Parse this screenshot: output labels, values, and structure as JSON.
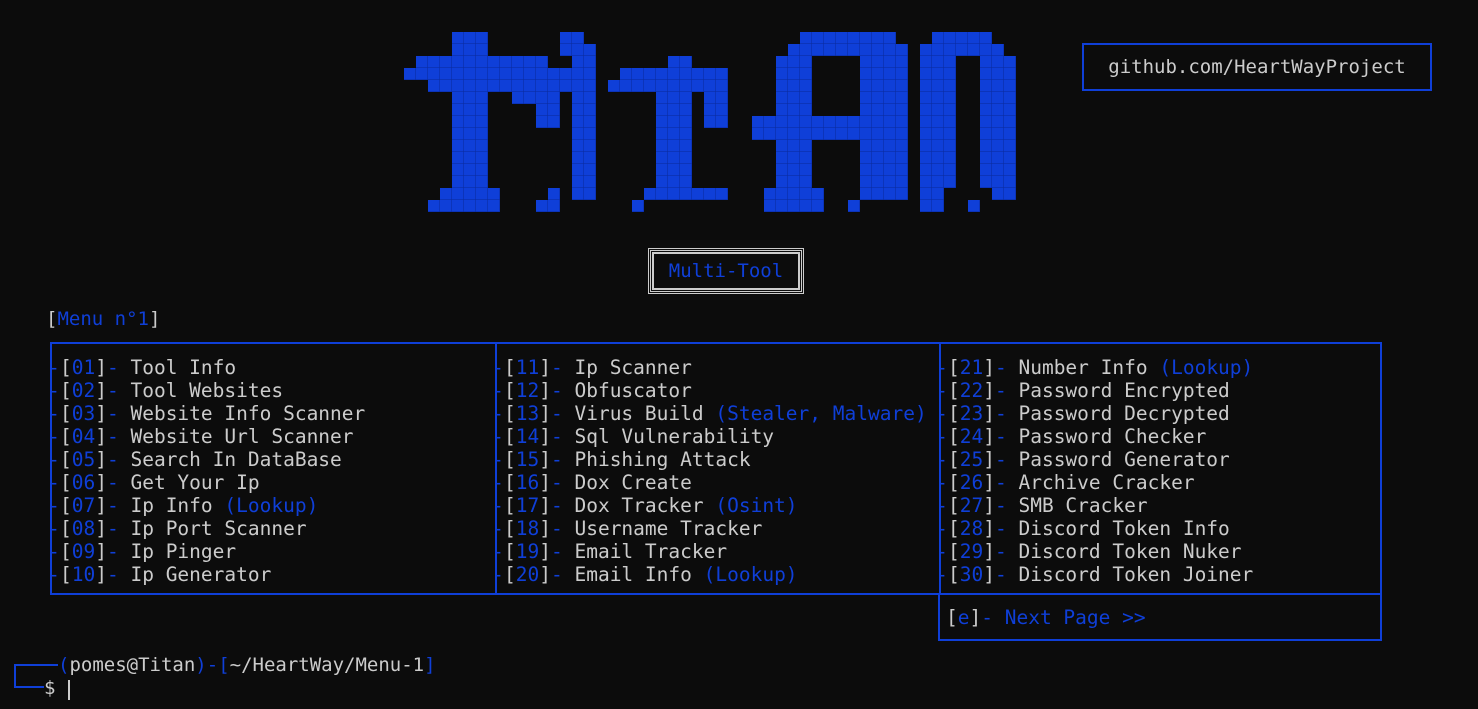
{
  "header": {
    "logo_text": "TITAN",
    "github_label": "github.com/HeartWayProject",
    "subtitle": "Multi-Tool"
  },
  "menu": {
    "title_prefix": "[",
    "title": "Menu n°1",
    "title_suffix": "]",
    "columns": [
      [
        {
          "num": "01",
          "label": "Tool Info",
          "extra": ""
        },
        {
          "num": "02",
          "label": "Tool Websites",
          "extra": ""
        },
        {
          "num": "03",
          "label": "Website Info Scanner",
          "extra": ""
        },
        {
          "num": "04",
          "label": "Website Url Scanner",
          "extra": ""
        },
        {
          "num": "05",
          "label": "Search In DataBase",
          "extra": ""
        },
        {
          "num": "06",
          "label": "Get Your Ip",
          "extra": ""
        },
        {
          "num": "07",
          "label": "Ip Info",
          "extra": "(Lookup)"
        },
        {
          "num": "08",
          "label": "Ip Port Scanner",
          "extra": ""
        },
        {
          "num": "09",
          "label": "Ip Pinger",
          "extra": ""
        },
        {
          "num": "10",
          "label": "Ip Generator",
          "extra": ""
        }
      ],
      [
        {
          "num": "11",
          "label": "Ip Scanner",
          "extra": ""
        },
        {
          "num": "12",
          "label": "Obfuscator",
          "extra": ""
        },
        {
          "num": "13",
          "label": "Virus Build",
          "extra": "(Stealer, Malware)"
        },
        {
          "num": "14",
          "label": "Sql Vulnerability",
          "extra": ""
        },
        {
          "num": "15",
          "label": "Phishing Attack",
          "extra": ""
        },
        {
          "num": "16",
          "label": "Dox Create",
          "extra": ""
        },
        {
          "num": "17",
          "label": "Dox Tracker",
          "extra": "(Osint)"
        },
        {
          "num": "18",
          "label": "Username Tracker",
          "extra": ""
        },
        {
          "num": "19",
          "label": "Email Tracker",
          "extra": ""
        },
        {
          "num": "20",
          "label": "Email Info",
          "extra": "(Lookup)"
        }
      ],
      [
        {
          "num": "21",
          "label": "Number Info",
          "extra": "(Lookup)"
        },
        {
          "num": "22",
          "label": "Password Encrypted",
          "extra": ""
        },
        {
          "num": "23",
          "label": "Password Decrypted",
          "extra": ""
        },
        {
          "num": "24",
          "label": "Password Checker",
          "extra": ""
        },
        {
          "num": "25",
          "label": "Password Generator",
          "extra": ""
        },
        {
          "num": "26",
          "label": "Archive Cracker",
          "extra": ""
        },
        {
          "num": "27",
          "label": "SMB Cracker",
          "extra": ""
        },
        {
          "num": "28",
          "label": "Discord Token Info",
          "extra": ""
        },
        {
          "num": "29",
          "label": "Discord Token Nuker",
          "extra": ""
        },
        {
          "num": "30",
          "label": "Discord Token Joiner",
          "extra": ""
        }
      ]
    ],
    "next": {
      "key": "e",
      "label": "Next Page >>"
    }
  },
  "prompt": {
    "user": "pomes@Titan",
    "path": "~/HeartWay/Menu-1",
    "symbol": "$"
  },
  "colors": {
    "accent": "#0f3fd8",
    "text": "#cccccc",
    "background": "#0c0c0c"
  }
}
